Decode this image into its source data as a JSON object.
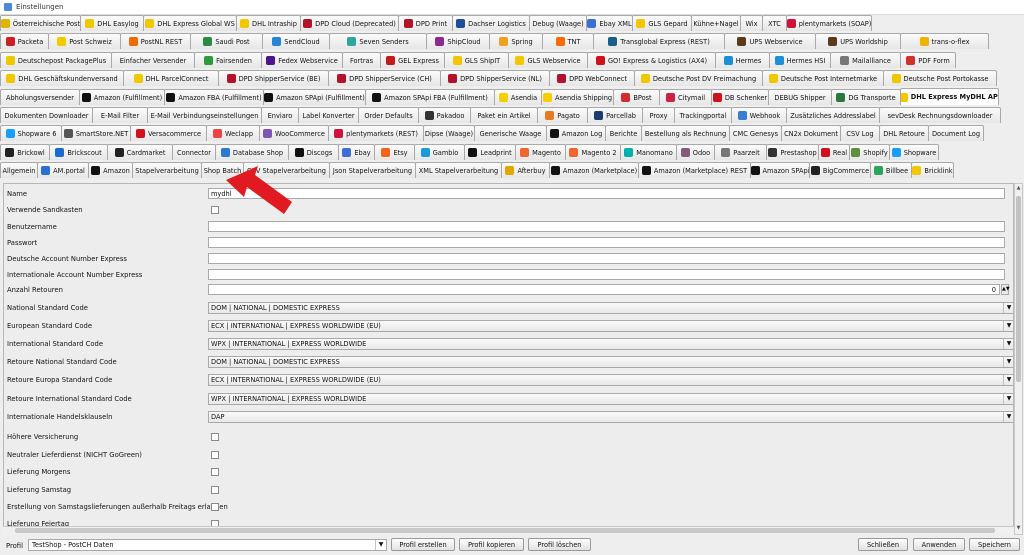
{
  "window": {
    "title": "Einstellungen"
  },
  "tab_rows": [
    [
      {
        "label": "Österreichische Post",
        "icon": "#e2b400",
        "w": 81
      },
      {
        "label": "DHL Easylog",
        "icon": "#f0c800",
        "w": 64
      },
      {
        "label": "DHL Express Global WS",
        "icon": "#f0c800",
        "w": 94
      },
      {
        "label": "DHL Intraship",
        "icon": "#f0c800",
        "w": 65
      },
      {
        "label": "DPD Cloud (Deprecated)",
        "icon": "#b4122a",
        "w": 99
      },
      {
        "label": "DPD Print",
        "icon": "#b4122a",
        "w": 55
      },
      {
        "label": "Dachser Logistics",
        "icon": "#1f4f9a",
        "w": 78
      },
      {
        "label": "Debug (Waage)",
        "icon": "",
        "w": 58
      },
      {
        "label": "Ebay XML",
        "icon": "#3c6fd0",
        "w": 47
      },
      {
        "label": "GLS Gepard",
        "icon": "#f2c700",
        "w": 60
      },
      {
        "label": "Kühne+Nagel",
        "icon": "",
        "w": 50
      },
      {
        "label": "Wix",
        "icon": "",
        "w": 23
      },
      {
        "label": "XTC",
        "icon": "",
        "w": 25
      },
      {
        "label": "plentymarkets (SOAP)",
        "icon": "#d0113b",
        "w": 86
      }
    ],
    [
      {
        "label": "Packeta",
        "icon": "#cc1f27",
        "w": 49
      },
      {
        "label": "Post Schweiz",
        "icon": "#f5c800",
        "w": 73
      },
      {
        "label": "PostNL REST",
        "icon": "#ee6b00",
        "w": 71
      },
      {
        "label": "Saudi Post",
        "icon": "#2b8a44",
        "w": 73
      },
      {
        "label": "SendCloud",
        "icon": "#2a84d6",
        "w": 68
      },
      {
        "label": "Seven Senders",
        "icon": "#2ea6a0",
        "w": 98
      },
      {
        "label": "ShipCloud",
        "icon": "#8e2a8e",
        "w": 64
      },
      {
        "label": "Spring",
        "icon": "#f0a020",
        "w": 54
      },
      {
        "label": "TNT",
        "icon": "#ff6a00",
        "w": 52
      },
      {
        "label": "Transglobal Express (REST)",
        "icon": "#1a5f8a",
        "w": 132
      },
      {
        "label": "UPS Webservice",
        "icon": "#5b3a1a",
        "w": 92
      },
      {
        "label": "UPS Worldship",
        "icon": "#5b3a1a",
        "w": 86
      },
      {
        "label": "trans-o-flex",
        "icon": "#f0b400",
        "w": 89
      }
    ],
    [
      {
        "label": "Deutschepost PackagePlus",
        "icon": "#f0c800",
        "w": 112
      },
      {
        "label": "Einfacher Versender",
        "icon": "",
        "w": 84
      },
      {
        "label": "Fairsenden",
        "icon": "#2d9a3c",
        "w": 68
      },
      {
        "label": "Fedex Webservice",
        "icon": "#4d148c",
        "w": 82
      },
      {
        "label": "Fortras",
        "icon": "",
        "w": 39
      },
      {
        "label": "GEL Express",
        "icon": "#c41a1a",
        "w": 65
      },
      {
        "label": "GLS ShipIT",
        "icon": "#f2c700",
        "w": 65
      },
      {
        "label": "GLS Webservice",
        "icon": "#f2c700",
        "w": 80
      },
      {
        "label": "GO! Express & Logistics (AX4)",
        "icon": "#d0111b",
        "w": 129
      },
      {
        "label": "Hermes",
        "icon": "#1c8fd6",
        "w": 55
      },
      {
        "label": "Hermes HSI",
        "icon": "#1c8fd6",
        "w": 62
      },
      {
        "label": "Mailalliance",
        "icon": "#777777",
        "w": 71
      },
      {
        "label": "PDF Form",
        "icon": "#d32f2f",
        "w": 56
      }
    ],
    [
      {
        "label": "DHL Geschäftskundenversand",
        "icon": "#f0c800",
        "w": 124
      },
      {
        "label": "DHL ParcelConnect",
        "icon": "#f0c800",
        "w": 96
      },
      {
        "label": "DPD ShipperService (BE)",
        "icon": "#b4122a",
        "w": 111
      },
      {
        "label": "DPD ShipperService (CH)",
        "icon": "#b4122a",
        "w": 113
      },
      {
        "label": "DPD ShipperService (NL)",
        "icon": "#b4122a",
        "w": 110
      },
      {
        "label": "DPD WebConnect",
        "icon": "#b4122a",
        "w": 86
      },
      {
        "label": "Deutsche Post DV Freimachung",
        "icon": "#f0c800",
        "w": 129
      },
      {
        "label": "Deutsche Post Internetmarke",
        "icon": "#f0c800",
        "w": 122
      },
      {
        "label": "Deutsche Post Portokasse",
        "icon": "#f0c800",
        "w": 114
      }
    ],
    [
      {
        "label": "Abholungsversender",
        "icon": "",
        "w": 80
      },
      {
        "label": "Amazon (Fulfillment)",
        "icon": "#111111",
        "w": 86
      },
      {
        "label": "Amazon FBA (Fulfillment)",
        "icon": "#111111",
        "w": 100
      },
      {
        "label": "Amazon SPApi (Fulfillment)",
        "icon": "#111111",
        "w": 103
      },
      {
        "label": "Amazon SPApi FBA (Fulfillment)",
        "icon": "#111111",
        "w": 130
      },
      {
        "label": "Asendia",
        "icon": "#f5d000",
        "w": 48
      },
      {
        "label": "Asendia Shipping",
        "icon": "#f5d000",
        "w": 73
      },
      {
        "label": "BPost",
        "icon": "#d42c2c",
        "w": 47
      },
      {
        "label": "Citymail",
        "icon": "#cc2244",
        "w": 53
      },
      {
        "label": "DB Schenker",
        "icon": "#d0111b",
        "w": 58
      },
      {
        "label": "DEBUG Shipper",
        "icon": "",
        "w": 64
      },
      {
        "label": "DG Transporte",
        "icon": "#2b7a3c",
        "w": 70
      },
      {
        "label": "DHL Express MyDHL API",
        "icon": "#f0c800",
        "w": 99,
        "selected": true
      }
    ],
    [
      {
        "label": "Dokumenten Downloader",
        "icon": "",
        "w": 93
      },
      {
        "label": "E-Mail Filter",
        "icon": "",
        "w": 56
      },
      {
        "label": "E-Mail Verbindungseinstellungen",
        "icon": "",
        "w": 115
      },
      {
        "label": "Enviaro",
        "icon": "",
        "w": 38
      },
      {
        "label": "Label Konverter",
        "icon": "",
        "w": 61
      },
      {
        "label": "Order Defaults",
        "icon": "",
        "w": 61
      },
      {
        "label": "Pakadoo",
        "icon": "#333333",
        "w": 53
      },
      {
        "label": "Paket ein Artikel",
        "icon": "",
        "w": 68
      },
      {
        "label": "Pagato",
        "icon": "#e87a20",
        "w": 51
      },
      {
        "label": "Parcellab",
        "icon": "#1c3b6e",
        "w": 56
      },
      {
        "label": "Proxy",
        "icon": "",
        "w": 33
      },
      {
        "label": "Trackingportal",
        "icon": "",
        "w": 58
      },
      {
        "label": "Webhook",
        "icon": "#3a7cd0",
        "w": 56
      },
      {
        "label": "Zusätzliches Addresslabel",
        "icon": "",
        "w": 94
      },
      {
        "label": "sevDesk Rechnungsdownloader",
        "icon": "",
        "w": 122
      }
    ],
    [
      {
        "label": "Shopware 6",
        "icon": "#189eff",
        "w": 62
      },
      {
        "label": "SmartStore.NET",
        "icon": "#555555",
        "w": 70
      },
      {
        "label": "Versacommerce",
        "icon": "#d0111b",
        "w": 77
      },
      {
        "label": "Weclapp",
        "icon": "#ef4444",
        "w": 54
      },
      {
        "label": "WooCommerce",
        "icon": "#7f54b3",
        "w": 70
      },
      {
        "label": "plentymarkets (REST)",
        "icon": "#d0113b",
        "w": 96
      },
      {
        "label": "Dipse (Waage)",
        "icon": "",
        "w": 52
      },
      {
        "label": "Generische Waage",
        "icon": "",
        "w": 73
      },
      {
        "label": "Amazon Log",
        "icon": "#111111",
        "w": 60
      },
      {
        "label": "Berichte",
        "icon": "",
        "w": 37
      },
      {
        "label": "Bestellung als Rechnung",
        "icon": "",
        "w": 89
      },
      {
        "label": "CMC Genesys",
        "icon": "",
        "w": 53
      },
      {
        "label": "CN2x Dokument",
        "icon": "",
        "w": 60
      },
      {
        "label": "CSV Log",
        "icon": "",
        "w": 40
      },
      {
        "label": "DHL Retoure",
        "icon": "",
        "w": 50
      },
      {
        "label": "Document Log",
        "icon": "",
        "w": 56
      }
    ],
    [
      {
        "label": "Brickowl",
        "icon": "#222222",
        "w": 50
      },
      {
        "label": "Brickscout",
        "icon": "#1a6ad0",
        "w": 59
      },
      {
        "label": "Cardmarket",
        "icon": "#222222",
        "w": 66
      },
      {
        "label": "Connector",
        "icon": "",
        "w": 44
      },
      {
        "label": "Database Shop",
        "icon": "#2a7ad0",
        "w": 74
      },
      {
        "label": "Discogs",
        "icon": "#111111",
        "w": 51
      },
      {
        "label": "Ebay",
        "icon": "#3c6fd0",
        "w": 37
      },
      {
        "label": "Etsy",
        "icon": "#f1641e",
        "w": 41
      },
      {
        "label": "Gambio",
        "icon": "#1a9bd7",
        "w": 51
      },
      {
        "label": "Leadprint",
        "icon": "#111111",
        "w": 52
      },
      {
        "label": "Magento",
        "icon": "#ee672f",
        "w": 51
      },
      {
        "label": "Magento 2",
        "icon": "#ee672f",
        "w": 56
      },
      {
        "label": "Manomano",
        "icon": "#00b2a9",
        "w": 57
      },
      {
        "label": "Odoo",
        "icon": "#875a7b",
        "w": 39
      },
      {
        "label": "Paarzeit",
        "icon": "#777777",
        "w": 53
      },
      {
        "label": "Prestashop",
        "icon": "#333333",
        "w": 53
      },
      {
        "label": "Real",
        "icon": "#d0111b",
        "w": 32
      },
      {
        "label": "Shopify",
        "icon": "#5e8e3e",
        "w": 41
      },
      {
        "label": "Shopware",
        "icon": "#189eff",
        "w": 50
      }
    ],
    [
      {
        "label": "Allgemein",
        "icon": "",
        "w": 38
      },
      {
        "label": "AM.portal",
        "icon": "#2b6fd0",
        "w": 52
      },
      {
        "label": "Amazon",
        "icon": "#111111",
        "w": 45
      },
      {
        "label": "Stapelverarbeitung",
        "icon": "",
        "w": 70
      },
      {
        "label": "Shop Batch",
        "icon": "",
        "w": 43
      },
      {
        "label": "CSV Stapelverarbeitung",
        "icon": "",
        "w": 87
      },
      {
        "label": "Json Stapelverarbeitung",
        "icon": "",
        "w": 87
      },
      {
        "label": "XML Stapelverarbeitung",
        "icon": "",
        "w": 87
      },
      {
        "label": "Afterbuy",
        "icon": "#e2a800",
        "w": 49
      },
      {
        "label": "Amazon (Marketplace)",
        "icon": "#111111",
        "w": 90
      },
      {
        "label": "Amazon (Marketplace) REST",
        "icon": "#111111",
        "w": 113
      },
      {
        "label": "Amazon SPApi",
        "icon": "#111111",
        "w": 60
      },
      {
        "label": "BigCommerce",
        "icon": "#222222",
        "w": 62
      },
      {
        "label": "Billbee",
        "icon": "#2aa65c",
        "w": 42
      },
      {
        "label": "Bricklink",
        "icon": "#f0c800",
        "w": 43
      }
    ]
  ],
  "form": {
    "name_label": "Name",
    "name_value": "mydhl",
    "sandkasten_label": "Verwende Sandkasten",
    "benutzername_label": "Benutzername",
    "passwort_label": "Passwort",
    "dean_label": "Deutsche Account Number Express",
    "iaen_label": "Internationale Account Number Express",
    "retouren_label": "Anzahl Retouren",
    "retouren_value": "0",
    "national_label": "National Standard Code",
    "national_value": "DOM | NATIONAL | DOMESTIC EXPRESS",
    "european_label": "European Standard Code",
    "european_value": "ECX | INTERNATIONAL | EXPRESS WORLDWIDE (EU)",
    "international_label": "International Standard Code",
    "international_value": "WPX | INTERNATIONAL | EXPRESS WORLDWIDE",
    "ret_national_label": "Retoure National Standard Code",
    "ret_national_value": "DOM | NATIONAL | DOMESTIC EXPRESS",
    "ret_europa_label": "Retoure Europa Standard Code",
    "ret_europa_value": "ECX | INTERNATIONAL | EXPRESS WORLDWIDE (EU)",
    "ret_international_label": "Retoure International Standard Code",
    "ret_international_value": "WPX | INTERNATIONAL | EXPRESS WORLDWIDE",
    "handelsklauseln_label": "Internationale Handelsklauseln",
    "handelsklauseln_value": "DAP",
    "hoehere_label": "Höhere Versicherung",
    "neutraler_label": "Neutraler Lieferdienst (NICHT GoGreen)",
    "morgens_label": "Lieferung Morgens",
    "samstag_label": "Lieferung Samstag",
    "erstellung_label": "Erstellung von Samstagslieferungen außerhalb Freitags erlauben",
    "feiertag_label": "Lieferung Feiertag"
  },
  "footer": {
    "profil_label": "Profil",
    "profil_value": "TestShop - PostCH Daten",
    "profil_erstellen": "Profil erstellen",
    "profil_kopieren": "Profil kopieren",
    "profil_loeschen": "Profil löschen",
    "schliessen": "Schließen",
    "anwenden": "Anwenden",
    "speichern": "Speichern"
  },
  "colors": {
    "arrow": "#e11a22"
  }
}
